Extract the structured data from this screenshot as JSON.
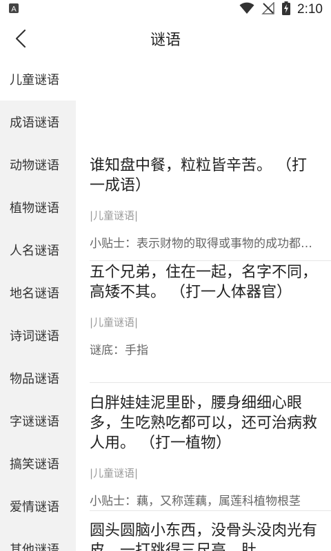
{
  "status": {
    "time": "2:10"
  },
  "header": {
    "title": "谜语"
  },
  "sidebar": {
    "items": [
      {
        "label": "儿童谜语"
      },
      {
        "label": "成语谜语"
      },
      {
        "label": "动物谜语"
      },
      {
        "label": "植物谜语"
      },
      {
        "label": "人名谜语"
      },
      {
        "label": "地名谜语"
      },
      {
        "label": "诗词谜语"
      },
      {
        "label": "物品谜语"
      },
      {
        "label": "字谜谜语"
      },
      {
        "label": "搞笑谜语"
      },
      {
        "label": "爱情谜语"
      },
      {
        "label": "其他谜语"
      }
    ]
  },
  "riddles": [
    {
      "question": "谁知盘中餐，粒粒皆辛苦。 （打一成语）",
      "category": "|儿童谜语|",
      "note": "小贴士：表示财物的取得或事物的成功都是来之不易的"
    },
    {
      "question": "五个兄弟，住在一起，名字不同，高矮不其。 （打一人体器官）",
      "category": "|儿童谜语|",
      "note": "谜底：手指"
    },
    {
      "question": "白胖娃娃泥里卧，腰身细细心眼多，生吃熟吃都可以，还可治病救人用。 （打一植物）",
      "category": "|儿童谜语|",
      "note": "小贴士：藕，又称莲藕，属莲科植物根茎"
    },
    {
      "question": "圆头圆脑小东西，没骨头没肉光有皮，一打跳得三尺高，肚",
      "category": "",
      "note": ""
    }
  ]
}
